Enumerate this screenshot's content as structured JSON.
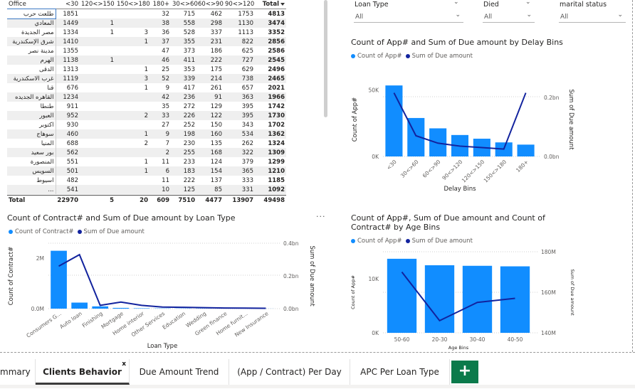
{
  "matrix": {
    "headers": [
      "Office",
      "<30",
      "120<>150",
      "150<>180",
      "180+",
      "30<>60",
      "60<>90",
      "90<>120",
      "Total"
    ],
    "rows": [
      {
        "office": "طلعت حرب",
        "v": [
          "1851",
          "",
          "",
          "32",
          "715",
          "462",
          "1753",
          "4813"
        ]
      },
      {
        "office": "المعادي",
        "v": [
          "1449",
          "1",
          "",
          "38",
          "558",
          "298",
          "1130",
          "3474"
        ]
      },
      {
        "office": "مصر الجديدة",
        "v": [
          "1334",
          "1",
          "3",
          "36",
          "528",
          "337",
          "1113",
          "3352"
        ]
      },
      {
        "office": "شرق الإسكندرية",
        "v": [
          "1410",
          "",
          "1",
          "37",
          "355",
          "231",
          "822",
          "2856"
        ]
      },
      {
        "office": "مدينة نصر",
        "v": [
          "1355",
          "",
          "",
          "47",
          "373",
          "186",
          "625",
          "2586"
        ]
      },
      {
        "office": "الهرم",
        "v": [
          "1138",
          "1",
          "",
          "46",
          "411",
          "222",
          "727",
          "2545"
        ]
      },
      {
        "office": "الدقى",
        "v": [
          "1313",
          "",
          "1",
          "25",
          "353",
          "175",
          "629",
          "2496"
        ]
      },
      {
        "office": "غرب الاسكندرية",
        "v": [
          "1119",
          "",
          "3",
          "52",
          "339",
          "214",
          "738",
          "2465"
        ]
      },
      {
        "office": "قنا",
        "v": [
          "676",
          "",
          "1",
          "9",
          "417",
          "261",
          "657",
          "2021"
        ]
      },
      {
        "office": "القاهره الجديده",
        "v": [
          "1234",
          "",
          "",
          "42",
          "236",
          "91",
          "363",
          "1966"
        ]
      },
      {
        "office": "طنطا",
        "v": [
          "911",
          "",
          "",
          "35",
          "272",
          "129",
          "395",
          "1742"
        ]
      },
      {
        "office": "العبور",
        "v": [
          "952",
          "",
          "2",
          "33",
          "226",
          "122",
          "395",
          "1730"
        ]
      },
      {
        "office": "اكتوبر",
        "v": [
          "930",
          "",
          "",
          "27",
          "252",
          "150",
          "343",
          "1702"
        ]
      },
      {
        "office": "سوهاج",
        "v": [
          "460",
          "",
          "1",
          "9",
          "198",
          "160",
          "534",
          "1362"
        ]
      },
      {
        "office": "المنيا",
        "v": [
          "688",
          "",
          "2",
          "7",
          "230",
          "135",
          "262",
          "1324"
        ]
      },
      {
        "office": "بور سعيد",
        "v": [
          "562",
          "",
          "",
          "2",
          "255",
          "168",
          "322",
          "1309"
        ]
      },
      {
        "office": "المنصورة",
        "v": [
          "551",
          "",
          "1",
          "11",
          "233",
          "124",
          "379",
          "1299"
        ]
      },
      {
        "office": "السويس",
        "v": [
          "501",
          "",
          "1",
          "6",
          "183",
          "154",
          "365",
          "1210"
        ]
      },
      {
        "office": "اسيوط",
        "v": [
          "482",
          "",
          "",
          "11",
          "222",
          "137",
          "333",
          "1185"
        ]
      },
      {
        "office": "...",
        "v": [
          "541",
          "",
          "",
          "10",
          "125",
          "85",
          "331",
          "1092"
        ]
      }
    ],
    "total": {
      "label": "Total",
      "v": [
        "22970",
        "5",
        "20",
        "609",
        "7510",
        "4477",
        "13907",
        "49498"
      ]
    }
  },
  "slicers": {
    "loan_type": {
      "title": "Loan Type",
      "value": "All"
    },
    "died": {
      "title": "Died",
      "value": "All"
    },
    "marital": {
      "title": "marital status",
      "value": "All"
    }
  },
  "delay_chart": {
    "title": "Count of App# and Sum of Due amount by Delay Bins",
    "legend": [
      "Count of App#",
      "Sum of Due amount"
    ]
  },
  "loan_chart": {
    "title": "Count of Contract# and Sum of Due amount by Loan Type",
    "legend": [
      "Count of Contract#",
      "Sum of Due amount"
    ],
    "more": "···"
  },
  "age_chart": {
    "title": "Count of App#, Sum of Due amount and Count of Contract# by Age Bins",
    "legend": [
      "Count of App#",
      "Sum of Due amount"
    ]
  },
  "colors": {
    "bar": "#118dff",
    "line": "#12239e"
  },
  "chart_data": [
    {
      "type": "bar",
      "title": "Count of App# and Sum of Due amount by Delay Bins",
      "categories": [
        "<30",
        "30<>60",
        "60<>90",
        "90<>120",
        "120<>150",
        "150<>180",
        "180+"
      ],
      "series": [
        {
          "name": "Count of App#",
          "axis": "left",
          "values": [
            48000,
            26000,
            19000,
            14500,
            12000,
            9500,
            8000
          ]
        },
        {
          "name": "Sum of Due amount",
          "axis": "right",
          "type": "line",
          "values": [
            0.215,
            0.07,
            0.045,
            0.035,
            0.03,
            0.025,
            0.215
          ]
        }
      ],
      "xlabel": "Delay Bins",
      "ylabel": "Count of App#",
      "y2label": "Sum of Due amount",
      "ylim": [
        0,
        50000
      ],
      "y2lim": [
        0,
        0.25
      ],
      "yticks": [
        "0K",
        "50K"
      ],
      "y2ticks": [
        "0.0bn",
        "0.2bn"
      ]
    },
    {
      "type": "bar",
      "title": "Count of Contract# and Sum of Due amount by Loan Type",
      "categories": [
        "Consumers G...",
        "Auto loan",
        "Finishing",
        "Mortgage",
        "Home interior",
        "Other Services",
        "Education",
        "Wedding",
        "Green finance",
        "Home furnit...",
        "New Insurance"
      ],
      "series": [
        {
          "name": "Count of Contract#",
          "axis": "left",
          "values": [
            2300000,
            240000,
            90000,
            30000,
            15000,
            10000,
            8000,
            6000,
            4000,
            3000,
            2000
          ]
        },
        {
          "name": "Sum of Due amount",
          "axis": "right",
          "type": "line",
          "values": [
            0.26,
            0.33,
            0.02,
            0.04,
            0.02,
            0.01,
            0.008,
            0.006,
            0.004,
            0.003,
            0.002
          ]
        }
      ],
      "xlabel": "Loan Type",
      "ylabel": "Count of Contract#",
      "y2label": "Sum of Due amount",
      "ylim": [
        0,
        2600000
      ],
      "y2lim": [
        0,
        0.4
      ],
      "yticks": [
        "0.0M",
        "2M"
      ],
      "y2ticks": [
        "0.0bn",
        "0.2bn",
        "0.4bn"
      ]
    },
    {
      "type": "bar",
      "title": "Count of App#, Sum of Due amount and Count of Contract# by Age Bins",
      "categories": [
        "50-60",
        "20-30",
        "30-40",
        "40-50"
      ],
      "series": [
        {
          "name": "Count of App#",
          "axis": "left",
          "values": [
            13700,
            12500,
            12400,
            12300
          ]
        },
        {
          "name": "Sum of Due amount",
          "axis": "right",
          "type": "line",
          "values": [
            170,
            146,
            155,
            157
          ]
        }
      ],
      "xlabel": "Age Bins",
      "ylabel": "Count of App#",
      "y2label": "Sum of Due amount",
      "ylim": [
        0,
        15000
      ],
      "y2lim": [
        140,
        180
      ],
      "yticks": [
        "0K",
        "10K"
      ],
      "y2ticks": [
        "140M",
        "160M",
        "180M"
      ]
    }
  ],
  "tabs": [
    {
      "label": "mmary"
    },
    {
      "label": "Clients Behavior",
      "close": "x"
    },
    {
      "label": "Due Amount Trend"
    },
    {
      "label": "(App / Contract) Per Day"
    },
    {
      "label": "APC Per Loan Type"
    }
  ],
  "add_tab": "+"
}
